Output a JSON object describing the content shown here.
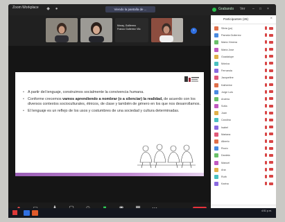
{
  "window": {
    "title": "Zoom Workplace"
  },
  "topbar": {
    "share_label": "Viendo la pantalla de ...",
    "rec_label": "Grabando",
    "view_label": "Ver"
  },
  "video_tiles": [
    {
      "name": ""
    },
    {
      "name": ""
    },
    {
      "name": "Moray, Guillermo\nFranco Gutierrez Vilc"
    },
    {
      "name": ""
    }
  ],
  "slide": {
    "bullets": [
      {
        "pre": "A partir del lenguaje, construimos socialmente la convivencia humana.",
        "bold": "",
        "post": ""
      },
      {
        "pre": "Conforme crecemos ",
        "bold": "vamos aprendiendo a nombrar (o a silenciar) la realidad,",
        "post": " de acuerdo con los diversos contextos socioculturales, étnicos, de clase y también de género en los que nos desarrollamos."
      },
      {
        "pre": "El lenguaje es un reflejo de los usos y costumbres de una sociedad y cultura determinadas.",
        "bold": "",
        "post": ""
      }
    ]
  },
  "toolbar": {
    "items": [
      {
        "icon": "microphone-icon",
        "label": "Audio"
      },
      {
        "icon": "video-camera-icon",
        "label": "Video"
      },
      {
        "icon": "participants-icon",
        "label": "Participantes"
      },
      {
        "icon": "chat-icon",
        "label": "Chat"
      },
      {
        "icon": "reactions-icon",
        "label": "Reacciones"
      },
      {
        "icon": "share-screen-icon",
        "label": "Compartir"
      },
      {
        "icon": "record-icon",
        "label": "Grabar"
      },
      {
        "icon": "apps-icon",
        "label": "Apps"
      },
      {
        "icon": "more-icon",
        "label": "Más"
      }
    ],
    "end_label": "Salir"
  },
  "participants": {
    "title": "Participantes (26)",
    "list": [
      {
        "name": "Silvia (yo)"
      },
      {
        "name": "Pamela Gutierrez"
      },
      {
        "name": "María Ximena"
      },
      {
        "name": "María Jose"
      },
      {
        "name": "Guadalupe"
      },
      {
        "name": "Mónica"
      },
      {
        "name": "Fernanda"
      },
      {
        "name": "Jacqueline"
      },
      {
        "name": "Katherine"
      },
      {
        "name": "Jorge Luis"
      },
      {
        "name": "Andrea"
      },
      {
        "name": "Sofía"
      },
      {
        "name": "Juan"
      },
      {
        "name": "Carolina"
      },
      {
        "name": "Isabel"
      },
      {
        "name": "Mariana"
      },
      {
        "name": "Alberto"
      },
      {
        "name": "Rocío"
      },
      {
        "name": "Daniela"
      },
      {
        "name": "Manuel"
      },
      {
        "name": "Ana"
      },
      {
        "name": "Ruth"
      },
      {
        "name": "Karina"
      }
    ],
    "invite_label": "Invitar",
    "mute_label": "Silenciar a todos"
  },
  "taskbar": {
    "time": "4:51 p.m.",
    "date": ""
  },
  "colors": {
    "accent": "#2f6fe0",
    "end": "#e8333b",
    "rec": "#27c04a",
    "slide_footer": "#9b5fb6"
  }
}
